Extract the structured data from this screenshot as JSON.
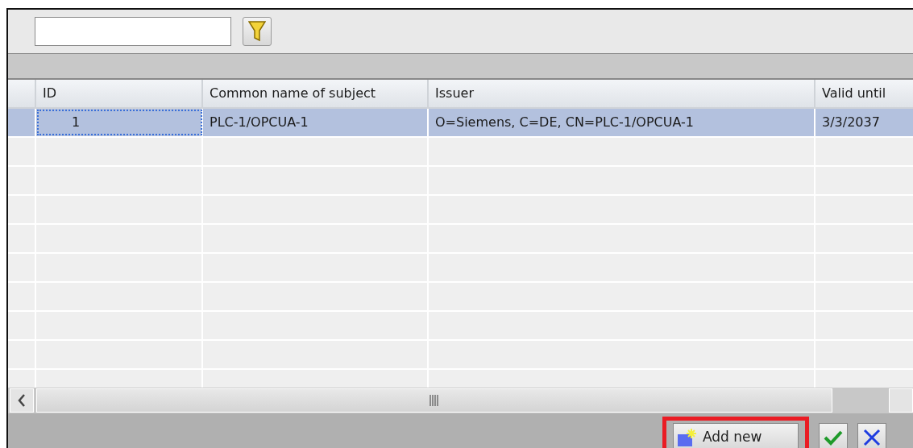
{
  "table": {
    "columns": [
      "ID",
      "Common name of subject",
      "Issuer",
      "Valid until"
    ],
    "rows": [
      {
        "selected": true,
        "focused": true,
        "cells": [
          "1",
          "PLC-1/OPCUA-1",
          "O=Siemens, C=DE, CN=PLC-1/OPCUA-1",
          "3/3/2037"
        ]
      }
    ]
  },
  "buttons": [
    {
      "kind": "add",
      "label": "Add new",
      "highlighted": true
    },
    {
      "kind": "confirm"
    },
    {
      "kind": "cancel"
    }
  ]
}
